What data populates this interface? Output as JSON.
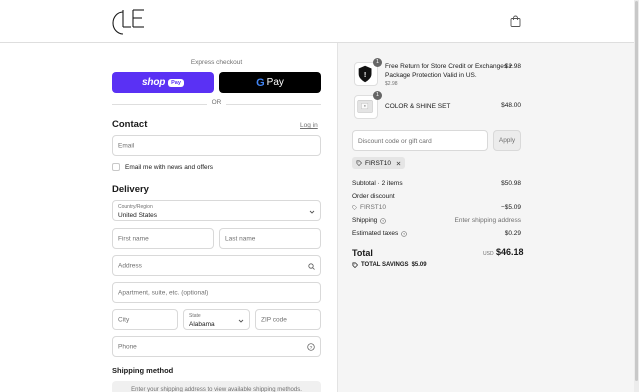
{
  "header": {
    "logo_text": "CLE",
    "cart_icon": "shopping-bag-icon"
  },
  "express": {
    "label": "Express checkout",
    "shop_pay_word": "shop",
    "shop_pay_pill": "Pay",
    "gpay_g": "G",
    "gpay_word": "Pay",
    "or": "OR",
    "shop_pay_color": "#5a31f4"
  },
  "contact": {
    "title": "Contact",
    "login": "Log in",
    "email_placeholder": "Email",
    "newsletter_label": "Email me with news and offers"
  },
  "delivery": {
    "title": "Delivery",
    "country_label": "Country/Region",
    "country_value": "United States",
    "first_name": "First name",
    "last_name": "Last name",
    "address": "Address",
    "apartment": "Apartment, suite, etc. (optional)",
    "city": "City",
    "state_label": "State",
    "state_value": "Alabama",
    "zip": "ZIP code",
    "phone": "Phone"
  },
  "shipping": {
    "title": "Shipping method",
    "note": "Enter your shipping address to view available shipping methods."
  },
  "order": {
    "items": [
      {
        "qty": "1",
        "name_line1": "Free Return for Store Credit or Exchanges +",
        "name_line2": "Package Protection Valid in US.",
        "sub": "$2.98",
        "price": "$2.98"
      },
      {
        "qty": "1",
        "name_line1": "COLOR & SHINE SET",
        "price": "$48.00"
      }
    ],
    "discount_placeholder": "Discount code or gift card",
    "apply": "Apply",
    "tag": "FIRST10",
    "subtotal_label": "Subtotal · 2 items",
    "subtotal_value": "$50.98",
    "order_discount_label": "Order discount",
    "discount_code": "FIRST10",
    "discount_value": "−$5.09",
    "shipping_label": "Shipping",
    "shipping_value": "Enter shipping address",
    "taxes_label": "Estimated taxes",
    "taxes_value": "$0.29",
    "total_label": "Total",
    "total_currency": "USD",
    "total_value": "$46.18",
    "savings_label": "TOTAL SAVINGS",
    "savings_value": "$5.09"
  }
}
